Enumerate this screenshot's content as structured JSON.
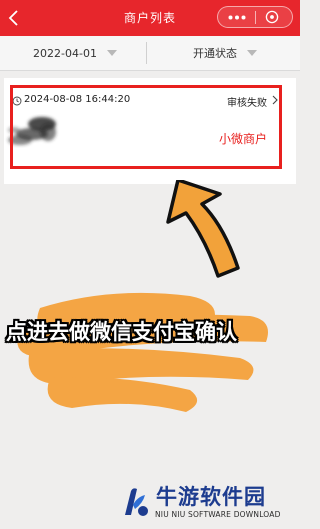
{
  "header": {
    "title": "商户列表",
    "back_icon": "chevron-left-icon",
    "more_icon": "more-dots-icon",
    "close_icon": "close-circle-icon",
    "bar_color": "#e7262c"
  },
  "filters": {
    "date": "2022-04-01",
    "status": "开通状态"
  },
  "merchant": {
    "datetime": "2024-08-08 16:44:20",
    "status": "审核失败",
    "type": "小微商户",
    "highlight_color": "#e8201e"
  },
  "annotation": {
    "caption": "点进去做微信支付宝确认",
    "brush_color": "#f5a23b"
  },
  "watermark": {
    "title": "牛游软件园",
    "subtitle": "NIU NIU SOFTWARE DOWNLOAD"
  }
}
